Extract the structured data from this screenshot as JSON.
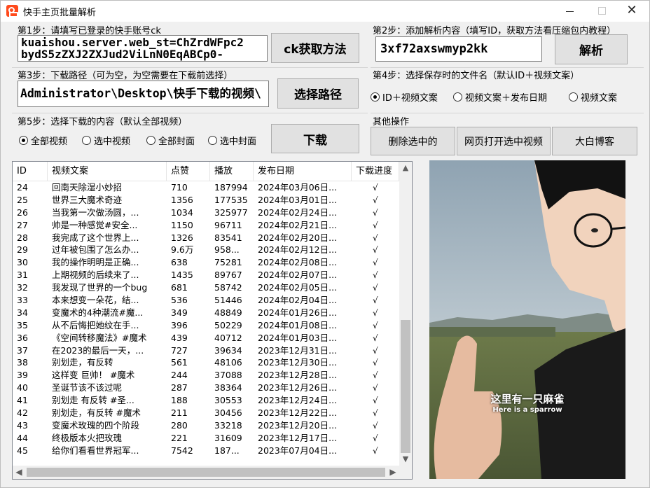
{
  "window": {
    "title": "快手主页批量解析",
    "minimize_glyph": "—",
    "close_glyph": "✕"
  },
  "step1": {
    "label": "第1步：请填写已登录的快手账号ck",
    "value": "kuaishou.server.web_st=ChZrdWFpc2\nbydS5zZXJ2ZXJud2ViLnN0EqABCp0-",
    "button": "ck获取方法"
  },
  "step2": {
    "label": "第2步：添加解析内容（填写ID，获取方法看压缩包内教程）",
    "value": "3xf72axswmyp2kk",
    "button": "解析"
  },
  "step3": {
    "label": "第3步：下载路径（可为空，为空需要在下载前选择）",
    "value": "Administrator\\Desktop\\快手下载的视频\\",
    "button": "选择路径"
  },
  "step4": {
    "label": "第4步：选择保存时的文件名（默认ID＋视频文案）",
    "options": [
      "ID＋视频文案",
      "视频文案＋发布日期",
      "视频文案"
    ],
    "selected": 0
  },
  "step5": {
    "label": "第5步：选择下载的内容（默认全部视频）",
    "options": [
      "全部视频",
      "选中视频",
      "全部封面",
      "选中封面"
    ],
    "selected": 0,
    "button": "下载"
  },
  "other": {
    "label": "其他操作",
    "buttons": [
      "删除选中的",
      "网页打开选中视频",
      "大白博客"
    ]
  },
  "table": {
    "headers": [
      "ID",
      "视频文案",
      "点赞",
      "播放",
      "发布日期",
      "下载进度"
    ],
    "rows": [
      [
        "24",
        "回南天除湿小妙招",
        "710",
        "187994",
        "2024年03月06日...",
        "√"
      ],
      [
        "25",
        "世界三大魔术奇迹",
        "1356",
        "177535",
        "2024年03月01日...",
        "√"
      ],
      [
        "26",
        "当我第一次做汤圆，...",
        "1034",
        "325977",
        "2024年02月24日...",
        "√"
      ],
      [
        "27",
        "帅是一种感觉#安全...",
        "1150",
        "96711",
        "2024年02月21日...",
        "√"
      ],
      [
        "28",
        "我完成了这个世界上...",
        "1326",
        "83541",
        "2024年02月20日...",
        "√"
      ],
      [
        "29",
        "过年被包围了怎么办...",
        "9.6万",
        "958...",
        "2024年02月12日...",
        "√"
      ],
      [
        "30",
        "我的操作明明是正确...",
        "638",
        "75281",
        "2024年02月08日...",
        "√"
      ],
      [
        "31",
        "上期视频的后续来了...",
        "1435",
        "89767",
        "2024年02月07日...",
        "√"
      ],
      [
        "32",
        "我发现了世界的一个bug",
        "681",
        "58742",
        "2024年02月05日...",
        "√"
      ],
      [
        "33",
        "本来想变一朵花，结...",
        "536",
        "51446",
        "2024年02月04日...",
        "√"
      ],
      [
        "34",
        "变魔术的4种潮流#魔...",
        "349",
        "48849",
        "2024年01月26日...",
        "√"
      ],
      [
        "35",
        "从不后悔把她纹在手...",
        "396",
        "50229",
        "2024年01月08日...",
        "√"
      ],
      [
        "36",
        "《空间转移魔法》#魔术",
        "439",
        "40712",
        "2024年01月03日...",
        "√"
      ],
      [
        "37",
        "在2023的最后一天，...",
        "727",
        "39634",
        "2023年12月31日...",
        "√"
      ],
      [
        "38",
        "别划走，有反转",
        "561",
        "48106",
        "2023年12月30日...",
        "√"
      ],
      [
        "39",
        "这样变  巨帅！  #魔术",
        "244",
        "37088",
        "2023年12月28日...",
        "√"
      ],
      [
        "40",
        "圣诞节该不该过呢",
        "287",
        "38364",
        "2023年12月26日...",
        "√"
      ],
      [
        "41",
        "别划走  有反转  #圣...",
        "188",
        "30553",
        "2023年12月24日...",
        "√"
      ],
      [
        "42",
        "别划走，有反转  #魔术",
        "211",
        "30456",
        "2023年12月22日...",
        "√"
      ],
      [
        "43",
        "变魔术玫瑰的四个阶段",
        "280",
        "33218",
        "2023年12月20日...",
        "√"
      ],
      [
        "44",
        "终极版本火把玫瑰",
        "221",
        "31609",
        "2023年12月17日...",
        "√"
      ],
      [
        "45",
        "给你们看看世界冠军...",
        "7542",
        "187...",
        "2023年07月04日...",
        "√"
      ]
    ]
  },
  "preview": {
    "subtitle_cn": "这里有一只麻雀",
    "subtitle_en": "Here is a sparrow"
  },
  "icons": {
    "app": "kuaishou-logo-icon",
    "scroll_up": "▲",
    "scroll_down": "▼",
    "scroll_left": "◀",
    "scroll_right": "▶"
  }
}
